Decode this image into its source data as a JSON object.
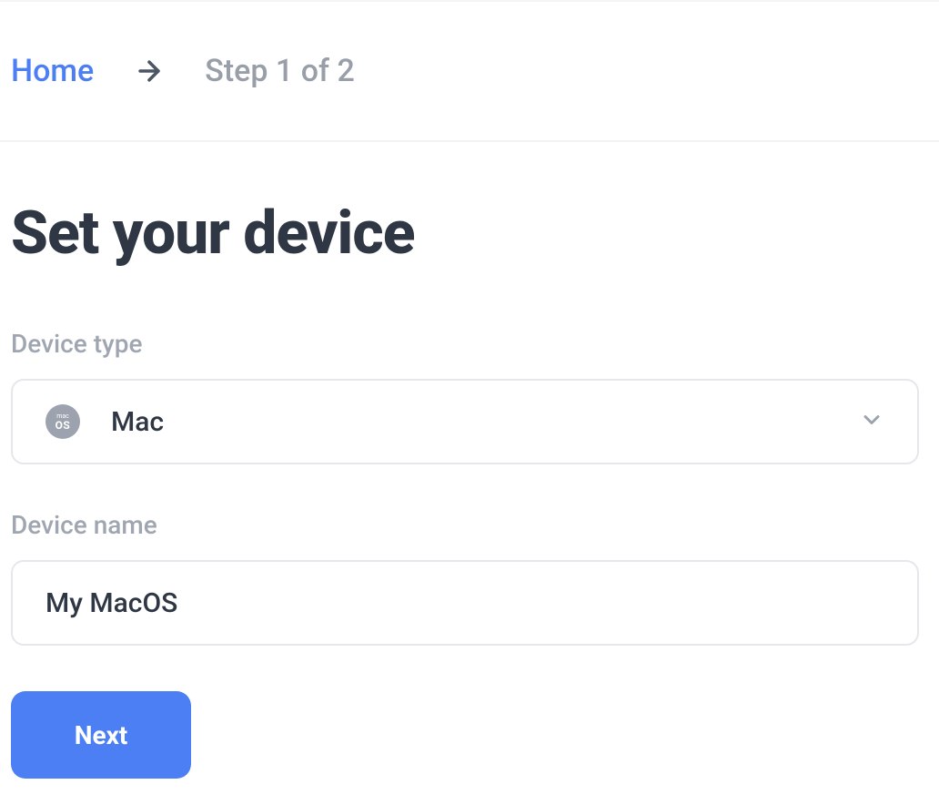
{
  "breadcrumb": {
    "home_label": "Home",
    "step_label": "Step 1 of 2"
  },
  "page_title": "Set your device",
  "form": {
    "device_type_label": "Device type",
    "device_type_value": "Mac",
    "device_type_icon_top": "mac",
    "device_type_icon_bottom": "OS",
    "device_name_label": "Device name",
    "device_name_value": "My MacOS"
  },
  "actions": {
    "next_label": "Next"
  }
}
